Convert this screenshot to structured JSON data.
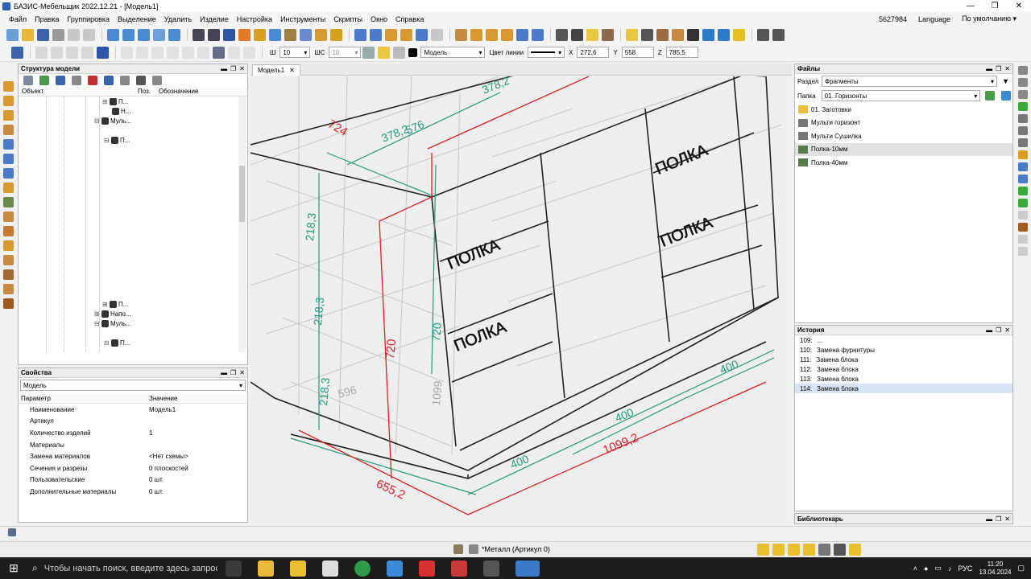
{
  "window": {
    "title": "БАЗИС-Мебельщик 2022.12.21 - [Модель1]"
  },
  "menu": {
    "items": [
      "Файл",
      "Правка",
      "Группировка",
      "Выделение",
      "Удалить",
      "Изделие",
      "Настройка",
      "Инструменты",
      "Скрипты",
      "Окно",
      "Справка"
    ],
    "right": {
      "id": "5627984",
      "language": "Language",
      "preset": "По умолчанию"
    }
  },
  "toolbar2": {
    "w_label": "Ш",
    "w_value": "10",
    "wc_label": "ШС",
    "wc_value": "10",
    "layer": "Модель",
    "line_color_label": "Цвет линии",
    "x_label": "X",
    "x_value": "272,6",
    "y_label": "Y",
    "y_value": "558",
    "z_label": "Z",
    "z_value": "785,5"
  },
  "structure": {
    "title": "Структура модели",
    "col_object": "Объект",
    "col_pos": "Поз.",
    "col_name": "Обозначение",
    "nodes": [
      "П...",
      "Н...",
      "Муль...",
      "П...",
      "Напо...",
      "Муль...",
      "П..."
    ]
  },
  "properties": {
    "title": "Свойства",
    "selector": "Модель",
    "col_param": "Параметр",
    "col_value": "Значение",
    "rows": [
      {
        "k": "Наименование",
        "v": "Модель1"
      },
      {
        "k": "Артикул",
        "v": ""
      },
      {
        "k": "Количество изделий",
        "v": "1"
      },
      {
        "k": "Материалы",
        "v": ""
      },
      {
        "k": "Замена материалов",
        "v": "<Нет схемы>"
      },
      {
        "k": "Сечения и разрезы",
        "v": "0 плоскостей"
      },
      {
        "k": "Пользовательские",
        "v": "0 шт."
      },
      {
        "k": "Дополнительные материалы",
        "v": "0 шт."
      }
    ]
  },
  "tab": {
    "label": "Модель1"
  },
  "files": {
    "title": "Файлы",
    "section_label": "Раздел",
    "section_value": "Фрагменты",
    "folder_label": "Папка",
    "folder_value": "01. Горизонты",
    "items": [
      "01. Заготовки",
      "Мульти горизонт",
      "Мульти Сушилка",
      "Полка-10мм",
      "Полка-40мм"
    ],
    "selected_index": 3
  },
  "history": {
    "title": "История",
    "rows": [
      {
        "n": "109:",
        "t": "..."
      },
      {
        "n": "110:",
        "t": "Замена фурнитуры"
      },
      {
        "n": "111:",
        "t": "Замена блока"
      },
      {
        "n": "112:",
        "t": "Замена блока"
      },
      {
        "n": "113:",
        "t": "Замена блока"
      },
      {
        "n": "114:",
        "t": "Замена блока"
      }
    ],
    "selected_index": 5
  },
  "librarian": {
    "title": "Библиотекарь"
  },
  "viewport": {
    "dims_red": [
      "724",
      "720",
      "655,2",
      "1099,2"
    ],
    "dims_green": [
      "378,2",
      "576",
      "378,2",
      "218,3",
      "218,3",
      "218,3",
      "720",
      "400",
      "400",
      "400",
      "596",
      "1099"
    ],
    "shelf_labels": [
      "ПОЛКА",
      "ПОЛКА",
      "ПОЛКА",
      "ПОЛКА"
    ]
  },
  "status": {
    "material": "*Металл (Артикул 0)"
  },
  "taskbar": {
    "search": "Чтобы начать поиск, введите здесь запрос",
    "lang": "РУС",
    "time": "11:20",
    "date": "13.04.2024"
  },
  "colors": {
    "dim_red": "#e0202a",
    "dim_green": "#1f9b7a",
    "accent": "#2b5fb4"
  }
}
